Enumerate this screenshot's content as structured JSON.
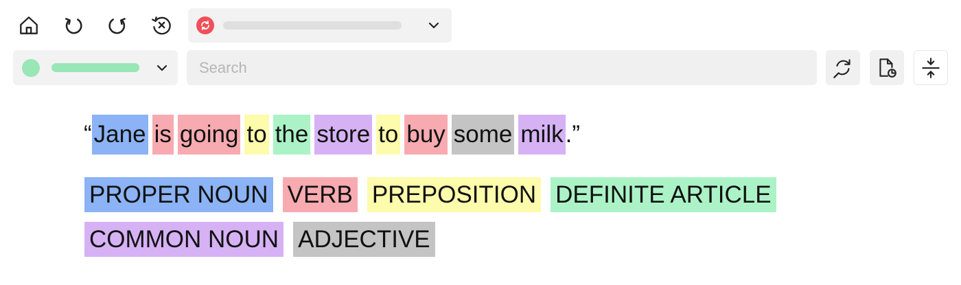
{
  "toolbar": {
    "icons": [
      "home-icon",
      "undo-icon",
      "redo-icon",
      "history-clear-icon"
    ]
  },
  "source_select": {
    "icon": "sync-icon",
    "color": "#f0505a"
  },
  "language_select": {
    "color": "#99e6b6"
  },
  "search": {
    "placeholder": "Search",
    "value": ""
  },
  "actions": {
    "icons": [
      "refresh-search-icon",
      "document-sync-icon",
      "split-vertical-icon"
    ]
  },
  "colors": {
    "proper_noun": "#8bb3f5",
    "verb": "#f8aab1",
    "preposition": "#fdfbac",
    "definite_article": "#abf3c7",
    "common_noun": "#d6b2f5",
    "adjective": "#c4c4c4"
  },
  "sentence": {
    "open_quote": "“",
    "close_quote": ".”",
    "tokens": [
      {
        "text": "Jane",
        "pos": "proper_noun"
      },
      {
        "text": "is",
        "pos": "verb"
      },
      {
        "text": "going",
        "pos": "verb"
      },
      {
        "text": "to",
        "pos": "preposition"
      },
      {
        "text": "the",
        "pos": "definite_article"
      },
      {
        "text": "store",
        "pos": "common_noun"
      },
      {
        "text": "to",
        "pos": "preposition"
      },
      {
        "text": "buy",
        "pos": "verb"
      },
      {
        "text": "some",
        "pos": "adjective"
      },
      {
        "text": "milk",
        "pos": "common_noun"
      }
    ]
  },
  "legend": [
    {
      "label": "PROPER NOUN",
      "pos": "proper_noun"
    },
    {
      "label": "VERB",
      "pos": "verb"
    },
    {
      "label": "PREPOSITION",
      "pos": "preposition"
    },
    {
      "label": "DEFINITE ARTICLE",
      "pos": "definite_article"
    },
    {
      "label": "COMMON NOUN",
      "pos": "common_noun"
    },
    {
      "label": "ADJECTIVE",
      "pos": "adjective"
    }
  ]
}
